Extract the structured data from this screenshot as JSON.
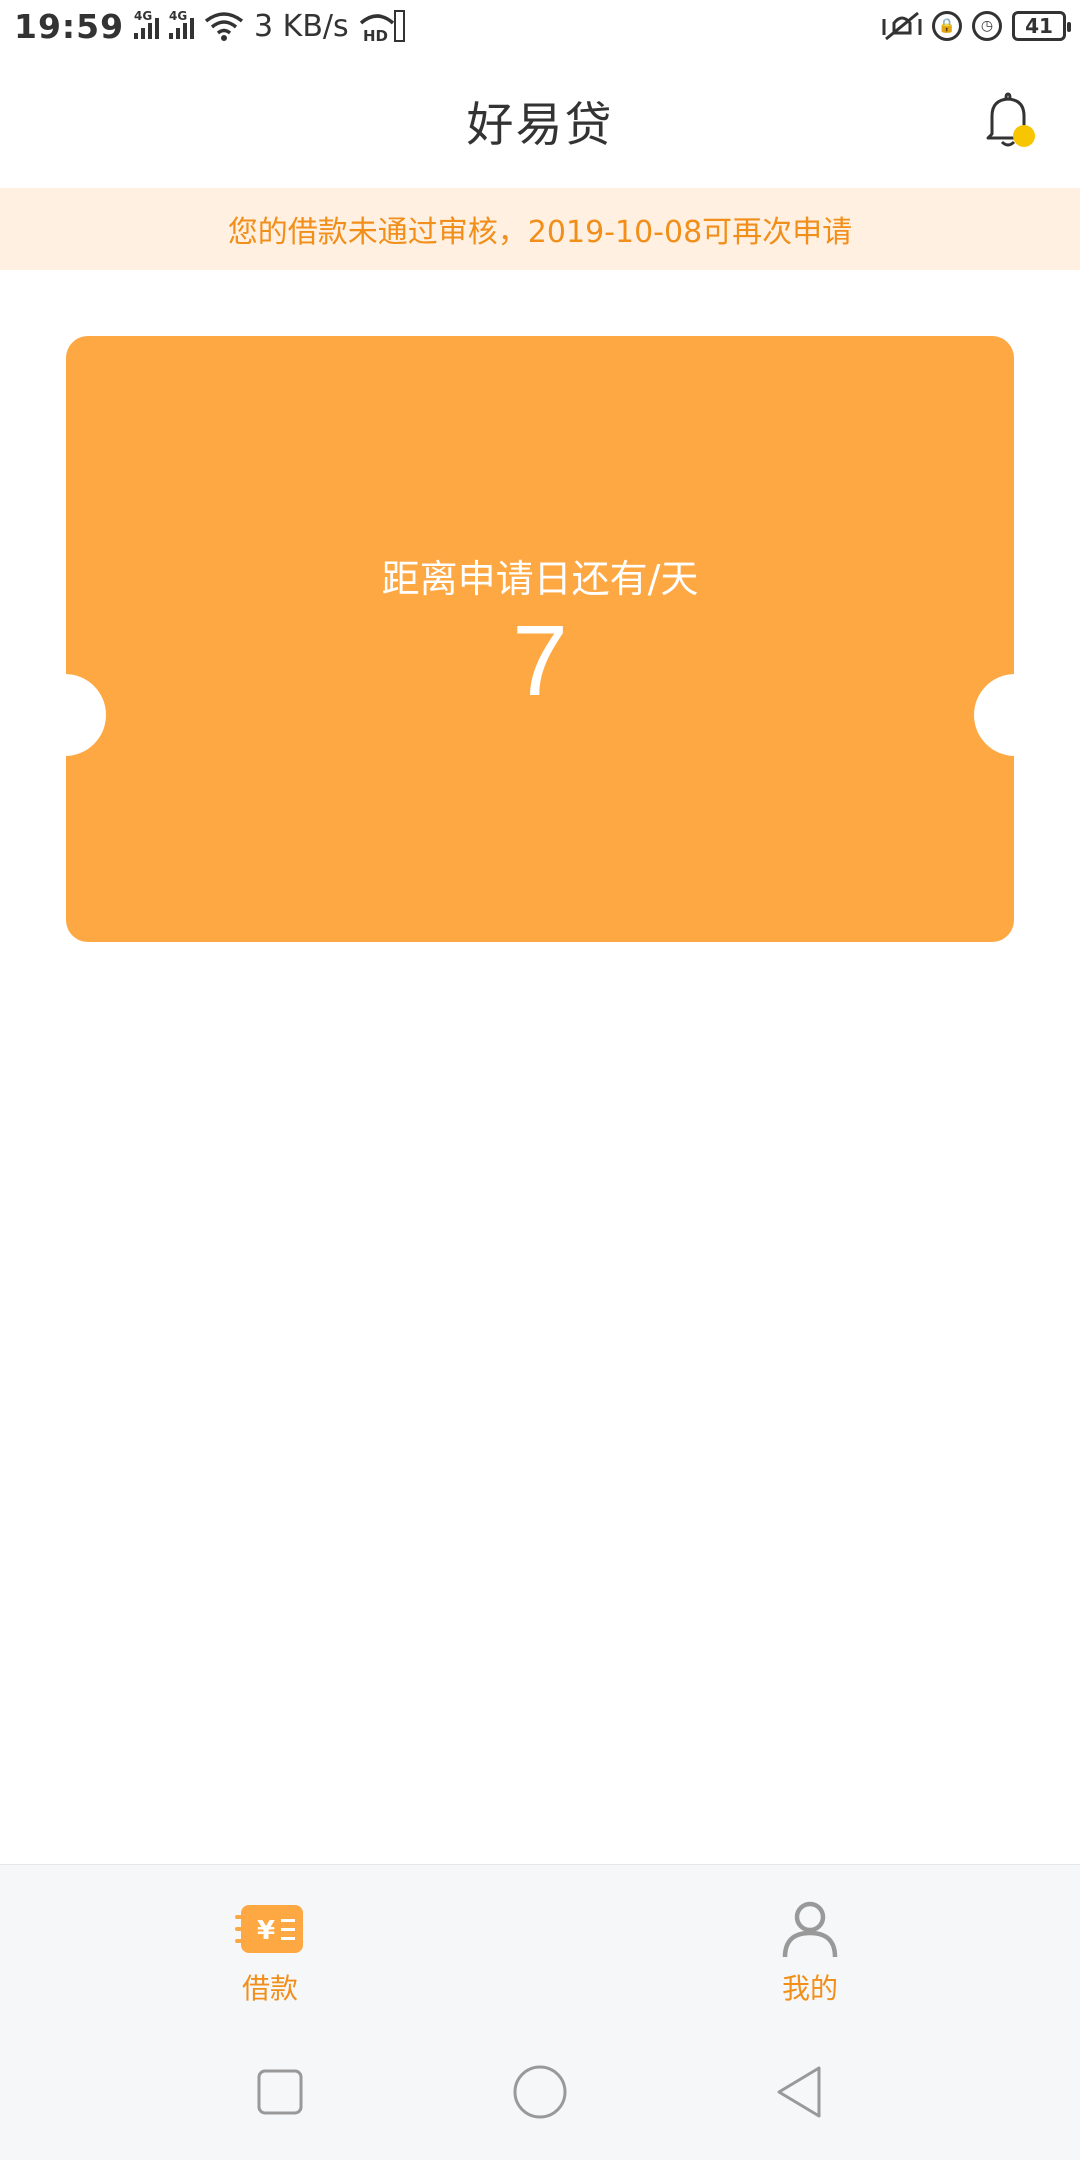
{
  "status_bar": {
    "time": "19:59",
    "network_speed": "3 KB/s",
    "signal_1_tag": "4G",
    "signal_2_tag": "4G",
    "hd_tag": "HD",
    "battery": "41"
  },
  "header": {
    "title": "好易贷"
  },
  "notice": {
    "text": "您的借款未通过审核，2019-10-08可再次申请"
  },
  "ticket": {
    "label": "距离申请日还有/天",
    "days": "7"
  },
  "tabs": [
    {
      "label": "借款",
      "icon": "loan-yen-icon"
    },
    {
      "label": "我的",
      "icon": "person-icon"
    }
  ],
  "colors": {
    "accent": "#fea843",
    "notice_bg": "#fff0e2",
    "notice_text": "#f18f1a",
    "badge": "#f7c600"
  }
}
